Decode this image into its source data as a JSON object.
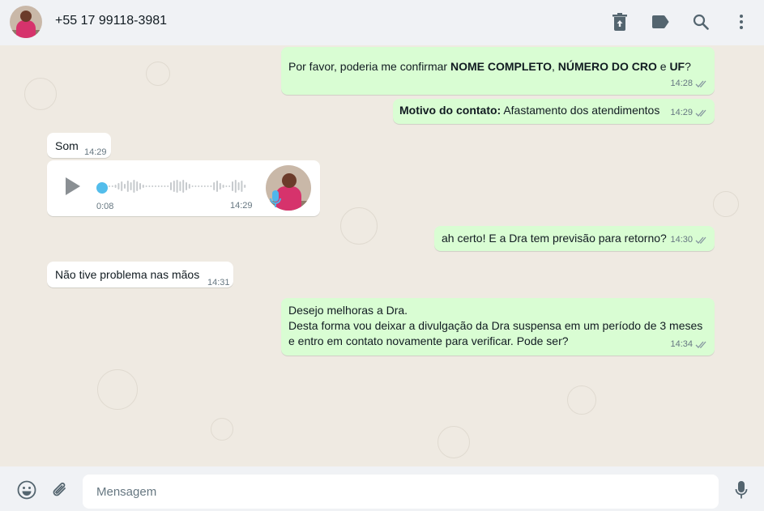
{
  "header": {
    "contact_phone": "+55 17 99118-3981",
    "icons": [
      "delete-icon",
      "label-icon",
      "search-icon",
      "menu-icon"
    ]
  },
  "messages": [
    {
      "dir": "out",
      "parts": [
        {
          "text": "Por favor, poderia me confirmar ",
          "bold": false
        },
        {
          "text": "NOME COMPLETO",
          "bold": true
        },
        {
          "text": ", ",
          "bold": false
        },
        {
          "text": "NÚMERO DO CRO",
          "bold": true
        },
        {
          "text": " e ",
          "bold": false
        },
        {
          "text": "UF",
          "bold": true
        },
        {
          "text": "?",
          "bold": false
        }
      ],
      "time": "14:28",
      "status": "read"
    },
    {
      "dir": "out",
      "parts": [
        {
          "text": "Motivo do contato:",
          "bold": true
        },
        {
          "text": " Afastamento dos atendimentos",
          "bold": false
        }
      ],
      "time": "14:29",
      "status": "read"
    },
    {
      "dir": "in",
      "text": "Som",
      "time": "14:29"
    },
    {
      "dir": "in",
      "type": "voice",
      "duration": "0:08",
      "time": "14:29",
      "progress": 0
    },
    {
      "dir": "out",
      "text": "ah certo! E a Dra tem previsão para retorno?",
      "time": "14:30",
      "status": "read"
    },
    {
      "dir": "in",
      "text": "Não tive problema nas mãos",
      "time": "14:31"
    },
    {
      "dir": "out",
      "lines": [
        "Desejo melhoras a Dra.",
        "Desta forma vou deixar a divulgação da Dra suspensa em um período de 3 meses",
        "e entro em contato novamente para verificar. Pode ser?"
      ],
      "time": "14:34",
      "status": "read"
    }
  ],
  "composer": {
    "placeholder": "Mensagem",
    "icons": [
      "emoji-icon",
      "attach-icon",
      "mic-icon"
    ]
  },
  "colors": {
    "outgoing_bubble": "#d9fdd3",
    "incoming_bubble": "#ffffff",
    "chat_background": "#efeae2",
    "header_background": "#f0f2f5",
    "audio_progress": "#53bdeb",
    "read_ticks": "#8696a0"
  }
}
